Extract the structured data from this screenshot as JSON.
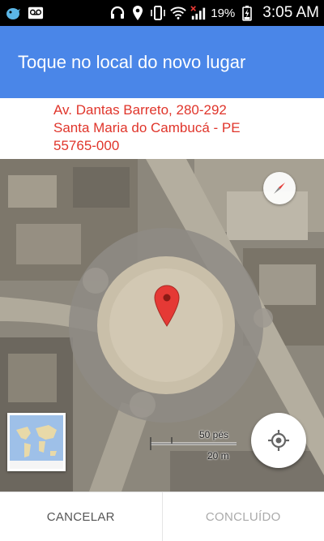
{
  "status_bar": {
    "battery_percent": "19%",
    "time": "3:05 AM",
    "icons": [
      "bird-icon",
      "voicemail-icon",
      "headset-icon",
      "location-icon",
      "vibrate-icon",
      "wifi-icon",
      "signal-icon",
      "battery-charging-icon"
    ]
  },
  "app_bar": {
    "title": "Toque no local do novo lugar",
    "color": "#4a86e8"
  },
  "address": {
    "line1": "Av. Dantas Barreto, 280-292",
    "line2": "Santa Maria do Cambucá - PE",
    "line3": "55765-000",
    "color": "#e0352b"
  },
  "map": {
    "scale_top": "50 pés",
    "scale_bottom": "20 m",
    "pin_color": "#e53935"
  },
  "actions": {
    "cancel_label": "CANCELAR",
    "done_label": "CONCLUÍDO"
  }
}
